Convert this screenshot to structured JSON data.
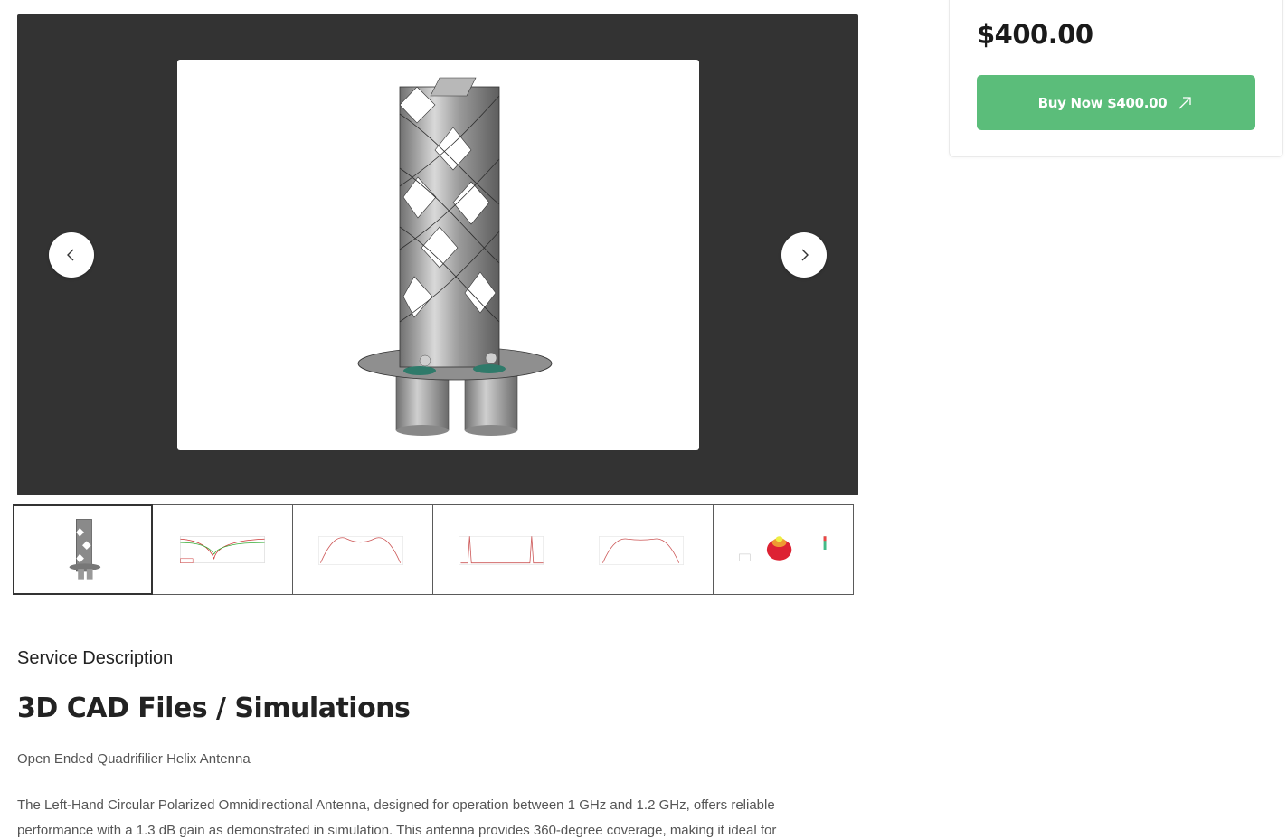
{
  "product": {
    "price": "$400.00",
    "buy_button_label": "Buy Now $400.00"
  },
  "gallery": {
    "main_image_alt": "Quadrifilar helix antenna 3D model",
    "thumbnails": [
      {
        "name": "antenna-3d-model"
      },
      {
        "name": "return-loss-plot"
      },
      {
        "name": "radiation-pattern-plot-1"
      },
      {
        "name": "frequency-response-plot"
      },
      {
        "name": "radiation-pattern-plot-2"
      },
      {
        "name": "3d-gain-pattern"
      }
    ]
  },
  "description": {
    "section_label": "Service Description",
    "heading": "3D CAD Files / Simulations",
    "subtitle": "Open Ended Quadrifilier Helix Antenna",
    "body": "The Left-Hand Circular Polarized Omnidirectional Antenna, designed for operation between 1 GHz and 1.2 GHz, offers reliable performance with a 1.3 dB gain as demonstrated in simulation. This antenna provides 360-degree coverage, making it ideal for"
  },
  "colors": {
    "accent_green": "#5bbd7a",
    "gallery_bg": "#333333"
  }
}
